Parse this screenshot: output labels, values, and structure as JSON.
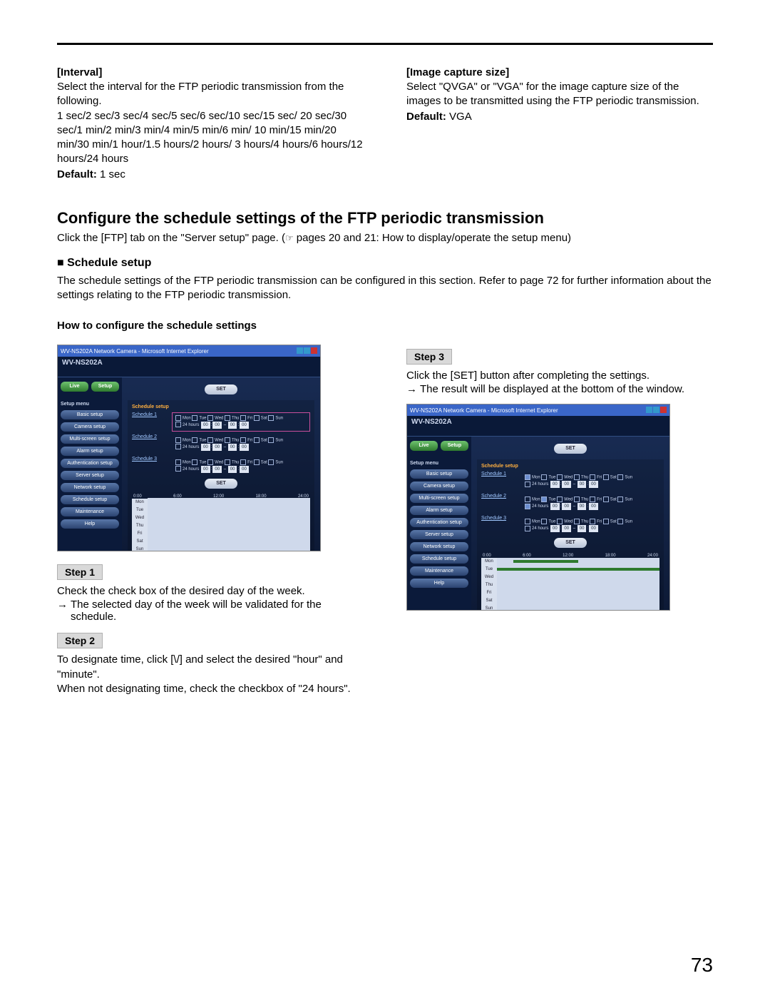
{
  "interval": {
    "title": "[Interval]",
    "desc": "Select the interval for the FTP periodic transmission from the following.",
    "options": "1 sec/2 sec/3 sec/4 sec/5 sec/6 sec/10 sec/15 sec/ 20 sec/30 sec/1 min/2 min/3 min/4 min/5 min/6 min/ 10 min/15 min/20 min/30 min/1 hour/1.5 hours/2 hours/ 3 hours/4 hours/6 hours/12 hours/24 hours",
    "default_label": "Default:",
    "default_value": "1 sec"
  },
  "image_size": {
    "title": "[Image capture size]",
    "desc": "Select \"QVGA\" or \"VGA\" for the image capture size of the images to be transmitted using the FTP periodic transmission.",
    "default_label": "Default:",
    "default_value": "VGA"
  },
  "configure": {
    "h2": "Configure the schedule settings of the FTP periodic transmission",
    "note_prefix": "Click the [FTP] tab on the \"Server setup\" page. (",
    "note_ref": "☞",
    "note_suffix": " pages 20 and 21: How to display/operate the setup menu)",
    "h3_prefix": "■ ",
    "h3": "Schedule setup",
    "body": "The schedule settings of the FTP periodic transmission can be configured in this section. Refer to page 72 for further information about the settings relating to the FTP periodic transmission.",
    "h4": "How to configure the schedule settings"
  },
  "steps": {
    "s1_label": "Step 1",
    "s1_text": "Check the check box of the desired day of the week.",
    "s1_arrow": "→",
    "s1_result": "The selected day of the week will be validated for the schedule.",
    "s2_label": "Step 2",
    "s2_text1": "To designate time, click [",
    "s2_vee": "\\/",
    "s2_text2": "] and select the desired \"hour\" and \"minute\".",
    "s2_text3": "When not designating time, check the checkbox of \"24 hours\".",
    "s3_label": "Step 3",
    "s3_text": "Click the [SET] button after completing the settings.",
    "s3_arrow": "→",
    "s3_result": "The result will be displayed at the bottom of the window."
  },
  "mock": {
    "wintitle": "WV-NS202A Network Camera - Microsoft Internet Explorer",
    "model": "WV-NS202A",
    "live": "Live",
    "setup": "Setup",
    "menu_header": "Setup menu",
    "side_items": [
      "Basic setup",
      "Camera setup",
      "Multi-screen setup",
      "Alarm setup",
      "Authentication setup",
      "Server setup",
      "Network setup",
      "Schedule setup",
      "Maintenance",
      "Help"
    ],
    "set_btn": "SET",
    "panel_title": "Schedule setup",
    "sched_links": [
      "Schedule 1",
      "Schedule 2",
      "Schedule 3"
    ],
    "days": [
      "Mon",
      "Tue",
      "Wed",
      "Thu",
      "Fri",
      "Sat",
      "Sun"
    ],
    "row_days": [
      "Mon",
      "Tue",
      "Wed",
      "Thu",
      "Fri",
      "Sat",
      "Sun"
    ],
    "hours_axis": [
      "0:00",
      "6:00",
      "12:00",
      "18:00",
      "24:00"
    ],
    "cb_24": "24 hours",
    "time_sel": [
      "00",
      "00",
      "00",
      "00"
    ]
  },
  "page_number": "73"
}
